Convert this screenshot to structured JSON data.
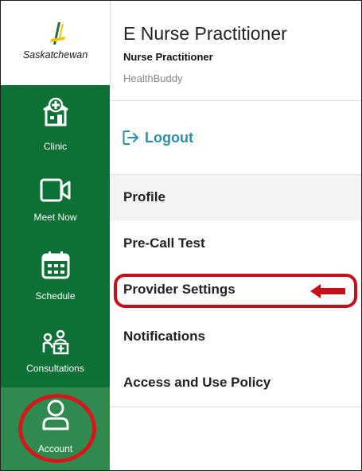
{
  "logo": {
    "wordmark": "Saskatchewan"
  },
  "sidebar": {
    "items": [
      {
        "label": "Clinic",
        "icon": "clinic-icon"
      },
      {
        "label": "Meet Now",
        "icon": "video-camera-icon"
      },
      {
        "label": "Schedule",
        "icon": "calendar-icon"
      },
      {
        "label": "Consultations",
        "icon": "consultation-icon"
      },
      {
        "label": "Account",
        "icon": "user-icon",
        "active": true
      }
    ]
  },
  "header": {
    "title": "E Nurse Practitioner",
    "role": "Nurse Practitioner",
    "organization": "HealthBuddy"
  },
  "logout": {
    "label": "Logout",
    "icon": "logout-icon"
  },
  "menu": {
    "items": [
      {
        "label": "Profile",
        "selected": true
      },
      {
        "label": "Pre-Call Test"
      },
      {
        "label": "Provider Settings",
        "highlighted": true
      },
      {
        "label": "Notifications"
      },
      {
        "label": "Access and Use Policy"
      }
    ]
  },
  "colors": {
    "sidebar": "#0d7035",
    "sidebar_active": "#2f8a4f",
    "link": "#2b8fb3",
    "annotation": "#c3111a"
  }
}
